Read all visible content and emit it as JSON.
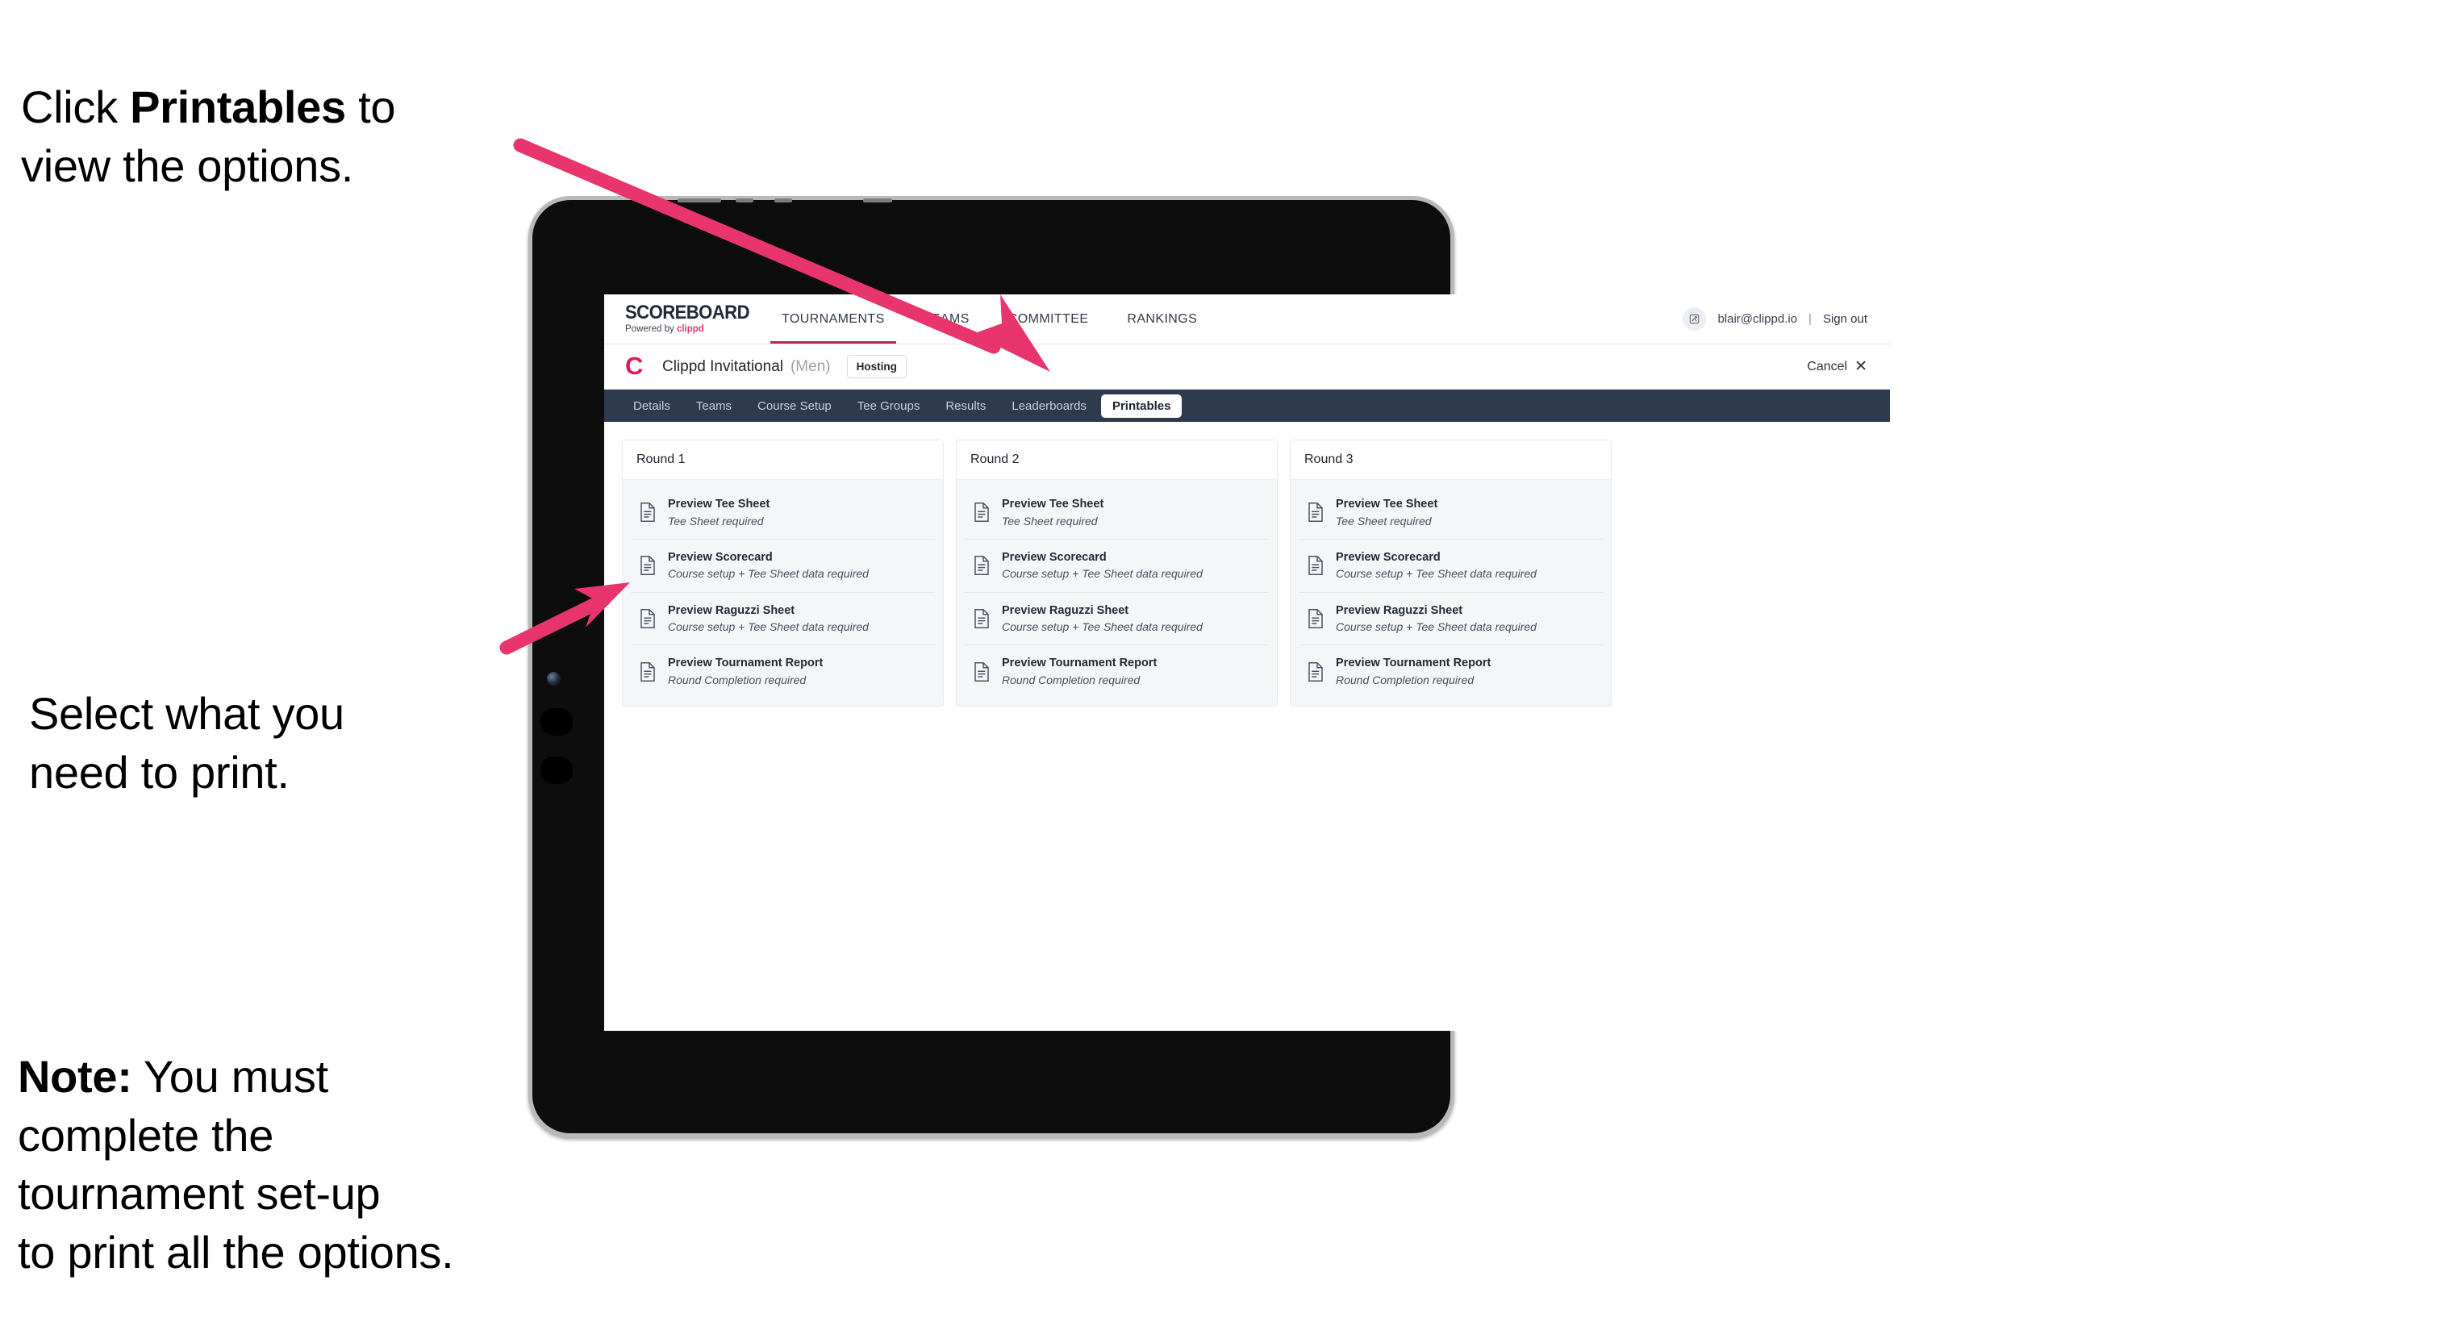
{
  "annotations": {
    "click_printables": {
      "prefix": "Click ",
      "bold": "Printables",
      "suffix": " to\nview the options."
    },
    "select_print": {
      "text": "Select what you\n need to print."
    },
    "note": {
      "bold": "Note:",
      "text": " You must\ncomplete the\ntournament set-up\nto print all the options."
    }
  },
  "accent_color": "#e8356d",
  "app": {
    "logo": {
      "word": "SCOREBOARD",
      "powered_prefix": "Powered by ",
      "brand": "clippd"
    },
    "nav": [
      {
        "label": "TOURNAMENTS",
        "active": true
      },
      {
        "label": "TEAMS",
        "active": false
      },
      {
        "label": "COMMITTEE",
        "active": false
      },
      {
        "label": "RANKINGS",
        "active": false
      }
    ],
    "account": {
      "avatar_icon": "user-avatar-icon",
      "email": "blair@clippd.io",
      "separator": "|",
      "sign_out": "Sign out"
    },
    "subheader": {
      "mark": "C",
      "tournament_name": "Clippd Invitational",
      "gender": "(Men)",
      "badge": "Hosting",
      "cancel_label": "Cancel",
      "cancel_icon": "close-x-icon"
    },
    "tabs": [
      {
        "label": "Details",
        "active": false
      },
      {
        "label": "Teams",
        "active": false
      },
      {
        "label": "Course Setup",
        "active": false
      },
      {
        "label": "Tee Groups",
        "active": false
      },
      {
        "label": "Results",
        "active": false
      },
      {
        "label": "Leaderboards",
        "active": false
      },
      {
        "label": "Printables",
        "active": true
      }
    ],
    "rounds": [
      {
        "title": "Round 1",
        "items": [
          {
            "title": "Preview Tee Sheet",
            "sub": "Tee Sheet required"
          },
          {
            "title": "Preview Scorecard",
            "sub": "Course setup + Tee Sheet data required"
          },
          {
            "title": "Preview Raguzzi Sheet",
            "sub": "Course setup + Tee Sheet data required"
          },
          {
            "title": "Preview Tournament Report",
            "sub": "Round Completion required"
          }
        ]
      },
      {
        "title": "Round 2",
        "items": [
          {
            "title": "Preview Tee Sheet",
            "sub": "Tee Sheet required"
          },
          {
            "title": "Preview Scorecard",
            "sub": "Course setup + Tee Sheet data required"
          },
          {
            "title": "Preview Raguzzi Sheet",
            "sub": "Course setup + Tee Sheet data required"
          },
          {
            "title": "Preview Tournament Report",
            "sub": "Round Completion required"
          }
        ]
      },
      {
        "title": "Round 3",
        "items": [
          {
            "title": "Preview Tee Sheet",
            "sub": "Tee Sheet required"
          },
          {
            "title": "Preview Scorecard",
            "sub": "Course setup + Tee Sheet data required"
          },
          {
            "title": "Preview Raguzzi Sheet",
            "sub": "Course setup + Tee Sheet data required"
          },
          {
            "title": "Preview Tournament Report",
            "sub": "Round Completion required"
          }
        ]
      }
    ]
  }
}
